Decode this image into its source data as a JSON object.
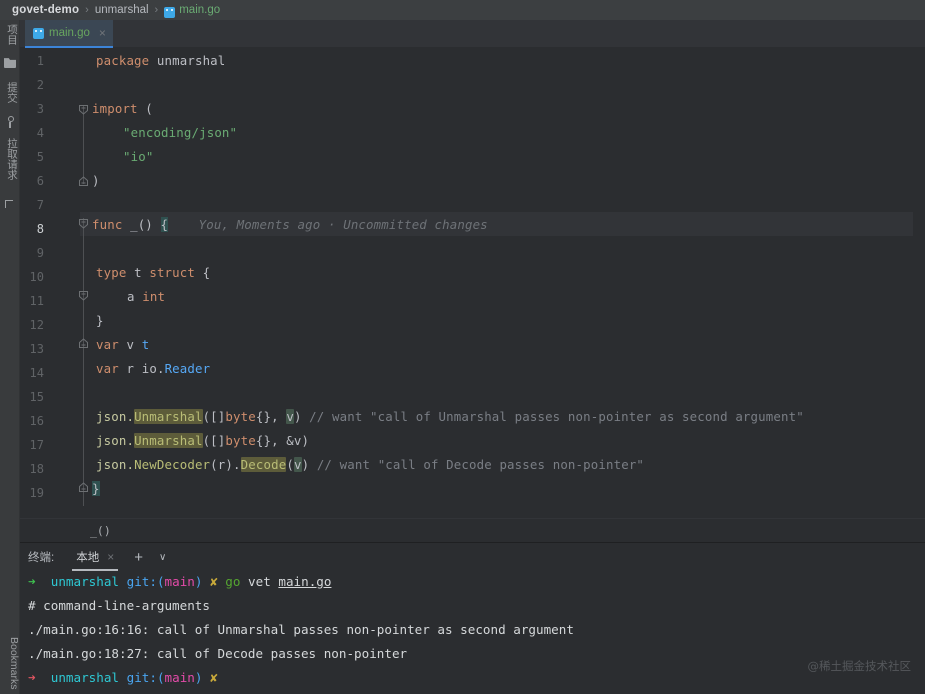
{
  "breadcrumb": {
    "items": [
      "govet-demo",
      "unmarshal",
      "main.go"
    ],
    "separator": "›",
    "file_icon": "go-file-icon"
  },
  "editor_tabs": [
    {
      "label": "main.go",
      "icon": "go-file-icon",
      "close": "×",
      "active": true
    }
  ],
  "left_tools": {
    "project": "项目",
    "commit": "提交",
    "pull_requests": "拉取请求",
    "bookmarks": "Bookmarks"
  },
  "editor": {
    "vcs_annotation": "You, Moments ago · Uncommitted changes",
    "current_line": 8,
    "breadcrumb_symbol": "_()",
    "lines": [
      {
        "n": 1,
        "text": "package unmarshal"
      },
      {
        "n": 2,
        "text": ""
      },
      {
        "n": 3,
        "text": "import ("
      },
      {
        "n": 4,
        "text": "    \"encoding/json\""
      },
      {
        "n": 5,
        "text": "    \"io\""
      },
      {
        "n": 6,
        "text": ")"
      },
      {
        "n": 7,
        "text": ""
      },
      {
        "n": 8,
        "text": "func _() {"
      },
      {
        "n": 9,
        "text": ""
      },
      {
        "n": 10,
        "text": "    type t struct {"
      },
      {
        "n": 11,
        "text": "        a int"
      },
      {
        "n": 12,
        "text": "    }"
      },
      {
        "n": 13,
        "text": "    var v t"
      },
      {
        "n": 14,
        "text": "    var r io.Reader"
      },
      {
        "n": 15,
        "text": ""
      },
      {
        "n": 16,
        "text": "    json.Unmarshal([]byte{}, v) // want \"call of Unmarshal passes non-pointer as second argument\""
      },
      {
        "n": 17,
        "text": "    json.Unmarshal([]byte{}, &v)"
      },
      {
        "n": 18,
        "text": "    json.NewDecoder(r).Decode(v) // want \"call of Decode passes non-pointer\""
      },
      {
        "n": 19,
        "text": "}"
      }
    ],
    "tokens": {
      "kw_package": "package",
      "pkgname": "unmarshal",
      "kw_import": "import",
      "str_json": "\"encoding/json\"",
      "str_io": "\"io\"",
      "kw_func": "func",
      "fn_name": "_()",
      "kw_type": "type",
      "ident_t": "t",
      "kw_struct": "struct",
      "field_a": "a",
      "type_int": "int",
      "kw_var": "var",
      "ident_v": "v",
      "ident_r": "r",
      "pkg_io": "io.",
      "type_reader": "Reader",
      "pkg_json": "json.",
      "fn_unmarshal": "Unmarshal",
      "type_byte": "byte",
      "fn_newdecoder": "NewDecoder",
      "fn_decode": "Decode",
      "comment16": "// want \"call of Unmarshal passes non-pointer as second argument\"",
      "comment18": "// want \"call of Decode passes non-pointer\""
    }
  },
  "terminal": {
    "title": "终端:",
    "tab_label": "本地",
    "tab_close": "×",
    "add_label": "+",
    "dropdown_label": "∨",
    "lines": [
      {
        "type": "prompt",
        "arrow": "➜",
        "arrow_color": "green",
        "dir": "unmarshal",
        "git": "git:",
        "branch_open": "(",
        "branch": "main",
        "branch_close": ")",
        "dirty": "✘",
        "cmd_name": "go",
        "cmd_args": "vet",
        "cmd_file": "main.go"
      },
      {
        "type": "out",
        "text": "# command-line-arguments"
      },
      {
        "type": "out",
        "text": "./main.go:16:16: call of Unmarshal passes non-pointer as second argument"
      },
      {
        "type": "out",
        "text": "./main.go:18:27: call of Decode passes non-pointer"
      },
      {
        "type": "prompt_empty",
        "arrow": "➜",
        "arrow_color": "red",
        "dir": "unmarshal",
        "git": "git:",
        "branch_open": "(",
        "branch": "main",
        "branch_close": ")",
        "dirty": "✘"
      }
    ]
  },
  "watermark": "@稀土掘金技术社区",
  "colors": {
    "bg": "#2b2d30",
    "topbar": "#3c3f41",
    "tab_active": "#3b4754",
    "tab_underline": "#3c84d8",
    "keyword": "#cf8e6d",
    "string": "#6aab73",
    "type": "#56a8f5",
    "function": "#b9bd76",
    "comment": "#7a7e85",
    "warn_highlight": "#5d5c3a",
    "sel_highlight": "#43564b"
  }
}
